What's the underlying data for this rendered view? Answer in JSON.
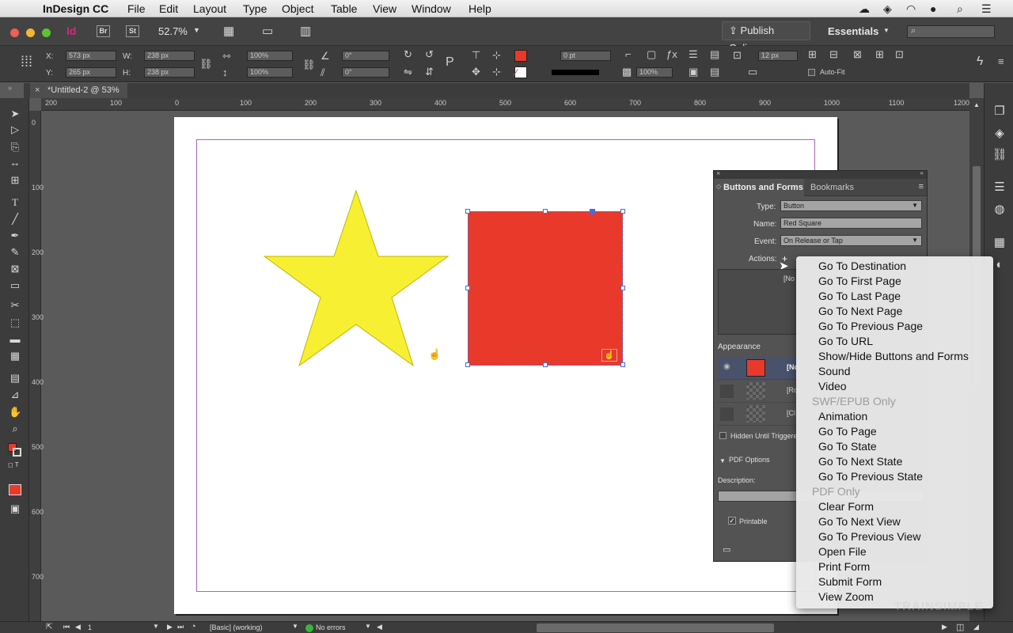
{
  "menubar": {
    "app_name": "InDesign CC",
    "items": [
      "File",
      "Edit",
      "Layout",
      "Type",
      "Object",
      "Table",
      "View",
      "Window",
      "Help"
    ]
  },
  "appbar": {
    "bridge_label": "Br",
    "stock_label": "St",
    "zoom": "52.7%",
    "publish_online": "Publish Online",
    "workspace": "Essentials"
  },
  "control": {
    "x_label": "X:",
    "x_value": "573 px",
    "y_label": "Y:",
    "y_value": "265 px",
    "w_label": "W:",
    "w_value": "238 px",
    "h_label": "H:",
    "h_value": "238 px",
    "scale_x": "100%",
    "scale_y": "100%",
    "rotate": "0°",
    "shear": "0°",
    "stroke_weight": "0 pt",
    "opacity": "100%",
    "offset": "12 px",
    "auto_fit": "Auto-Fit",
    "fill_color": "#e8392b"
  },
  "document": {
    "tab_title": "*Untitled-2 @ 53%",
    "ruler_h": [
      "200",
      "100",
      "0",
      "100",
      "200",
      "300",
      "400",
      "500",
      "600",
      "700",
      "800",
      "900",
      "1000",
      "1100",
      "1200"
    ],
    "ruler_v": [
      "0",
      "100",
      "200",
      "300",
      "400",
      "500",
      "600",
      "700"
    ],
    "star_color": "#f7f032",
    "square_color": "#e8392b"
  },
  "panel": {
    "tab_active": "Buttons and Forms",
    "tab_inactive": "Bookmarks",
    "type_label": "Type:",
    "type_value": "Button",
    "name_label": "Name:",
    "name_value": "Red Square",
    "event_label": "Event:",
    "event_value": "On Release or Tap",
    "actions_label": "Actions:",
    "actions_none": "[No",
    "appearance_label": "Appearance",
    "states": [
      "[No",
      "[Ro",
      "[Cl"
    ],
    "hidden_label": "Hidden Until Triggere",
    "pdf_options": "PDF Options",
    "description_label": "Description:",
    "printable_label": "Printable"
  },
  "popup": {
    "items_a": [
      "Go To Destination",
      "Go To First Page",
      "Go To Last Page",
      "Go To Next Page",
      "Go To Previous Page",
      "Go To URL",
      "Show/Hide Buttons and Forms",
      "Sound",
      "Video"
    ],
    "header_swf": "SWF/EPUB Only",
    "items_b": [
      "Animation",
      "Go To Page",
      "Go To State",
      "Go To Next State",
      "Go To Previous State"
    ],
    "header_pdf": "PDF Only",
    "items_c": [
      "Clear Form",
      "Go To Next View",
      "Go To Previous View",
      "Open File",
      "Print Form",
      "Submit Form",
      "View Zoom"
    ]
  },
  "status": {
    "page_number": "1",
    "preflight_profile": "[Basic] (working)",
    "errors": "No errors"
  },
  "watermark": "TRAINSIMPLE"
}
